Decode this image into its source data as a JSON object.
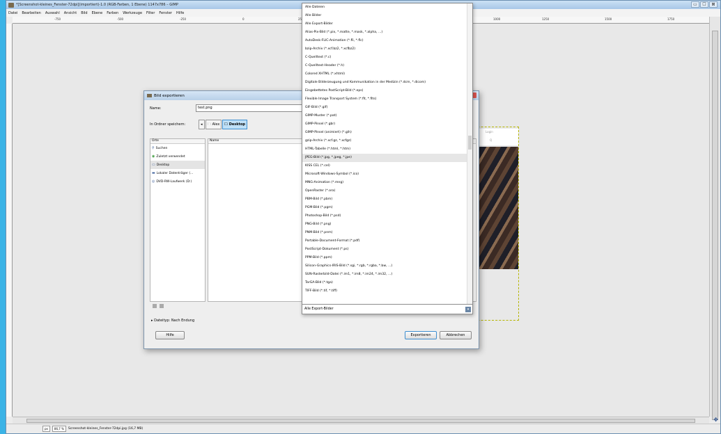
{
  "window": {
    "title": "*[Screenshot-kleines_Fenster-72dpi](importiert)-1.0 (RGB-Farben, 1 Ebene) 1147x786 – GIMP",
    "minimize": "▭",
    "maximize": "☐",
    "close": "⊠"
  },
  "menu": [
    "Datei",
    "Bearbeiten",
    "Auswahl",
    "Ansicht",
    "Bild",
    "Ebene",
    "Farben",
    "Werkzeuge",
    "Filter",
    "Fenster",
    "Hilfe"
  ],
  "ruler_ticks": [
    "-750",
    "-500",
    "-250",
    "0",
    "250",
    "1000",
    "1250",
    "1500",
    "1750"
  ],
  "status": {
    "unit": "px",
    "zoom": "86,7 %",
    "text": "Screenshot-kleines_Fenster-72dpi.jpg (16,7 MB)"
  },
  "dialog": {
    "title": "Bild exportieren",
    "name_label": "Name:",
    "name_value": "test.png",
    "folder_label": "In Ordner speichern:",
    "path": [
      "Alex",
      "Desktop"
    ],
    "places_header": "Orte",
    "places": [
      {
        "label": "Suchen",
        "icon": "search-icon"
      },
      {
        "label": "Zuletzt verwendet",
        "icon": "recent-icon"
      },
      {
        "label": "Desktop",
        "icon": "folder-icon"
      },
      {
        "label": "Lokaler Datenträger (...",
        "icon": "drive-icon"
      },
      {
        "label": "DVD-RW-Laufwerk (D:)",
        "icon": "dvd-icon"
      }
    ],
    "files_header": "Name",
    "filetype_label": "Dateityp: Nach Endung",
    "help": "Hilfe",
    "export": "Exportieren",
    "cancel": "Abbrechen"
  },
  "dropdown": {
    "items": [
      "Alle Dateien",
      "Alle Bilder",
      "Alle Export-Bilder",
      "Alias-Pix-Bild (*.pix, *.matte, *.mask, *.alpha, ...)",
      "AutoDesk-FLIC-Animation (*.fli, *.flc)",
      "bzip-Archiv (*.xcf.bz2, *.xcfbz2)",
      "C-Quelltext (*.c)",
      "C-Quelltext-Header (*.h)",
      "Colored XHTML (*.xhtml)",
      "Digitale Bilderzeugung und Kommunikation in der Medizin (*.dcm, *.dicom)",
      "Eingebettetes PostScript-Bild (*.eps)",
      "Flexible Image Transport System (*.fit, *.fits)",
      "GIF-Bild (*.gif)",
      "GIMP-Muster (*.pat)",
      "GIMP-Pinsel (*.gbr)",
      "GIMP-Pinsel (animiert) (*.gih)",
      "gzip-Archiv (*.xcf.gz, *.xcfgz)",
      "HTML-Tabelle (*.html, *.htm)",
      "JPEG-Bild (*.jpg, *.jpeg, *.jpe)",
      "KISS CEL (*.cel)",
      "Microsoft-Windows-Symbol (*.ico)",
      "MNG-Animation (*.mng)",
      "OpenRaster (*.ora)",
      "PBM-Bild (*.pbm)",
      "PGM-Bild (*.pgm)",
      "Photoshop-Bild (*.psd)",
      "PNG-Bild (*.png)",
      "PNM-Bild (*.pnm)",
      "Portable-Document-Format (*.pdf)",
      "PostScript-Dokument (*.ps)",
      "PPM-Bild (*.ppm)",
      "Silicon-Graphics-IRIS-Bild (*.sgi, *.rgb, *.rgba, *.bw, ...)",
      "SUN-Rasterbild-Datei (*.im1, *.im8, *.im24, *.im32, ...)",
      "TarGA-Bild (*.tga)",
      "TIFF-Bild (*.tif, *.tiff)"
    ],
    "highlighted_index": 18,
    "selected": "Alle Export-Bilder",
    "arrow": "▾"
  },
  "preview": {
    "header": "Login",
    "search": "Q"
  }
}
